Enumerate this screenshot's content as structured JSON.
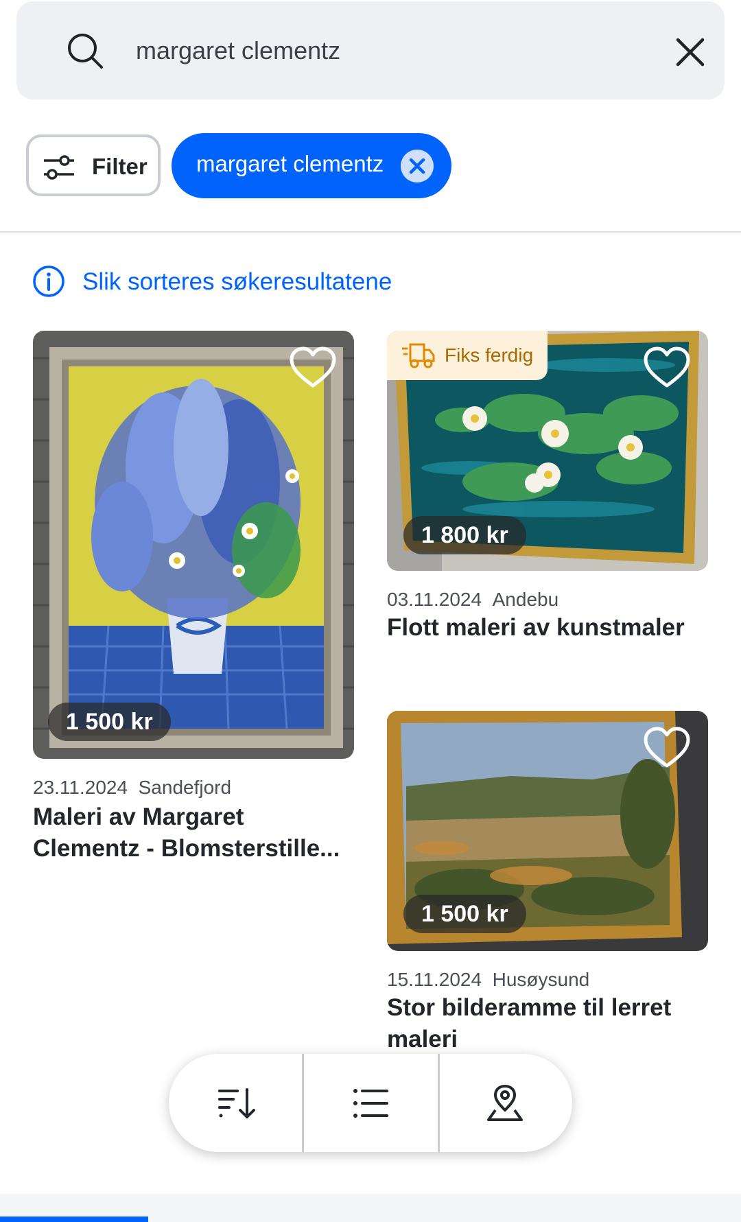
{
  "search": {
    "query": "margaret clementz"
  },
  "filters": {
    "filter_label": "Filter",
    "active_chip": "margaret clementz"
  },
  "info_link": "Slik sorteres søkeresultatene",
  "colors": {
    "accent": "#0063fb",
    "badge_bg": "#fdf1dc",
    "badge_text": "#a86a00"
  },
  "listings": [
    {
      "price": "1 500 kr",
      "date": "23.11.2024",
      "location": "Sandefjord",
      "title": "Maleri av Margaret Clementz - Blomsterstille...",
      "image": "painting-lupins-vase"
    },
    {
      "badge": "Fiks ferdig",
      "badge_icon": "delivery-truck-icon",
      "price": "1 800 kr",
      "date": "03.11.2024",
      "location": "Andebu",
      "title": "Flott maleri av kunstmaler",
      "image": "painting-water-lilies"
    },
    {
      "price": "1 500 kr",
      "date": "15.11.2024",
      "location": "Husøysund",
      "title": "Stor bilderamme til lerret maleri",
      "image": "painting-landscape"
    }
  ],
  "toolbar": {
    "items": [
      "sort-icon",
      "list-view-icon",
      "map-pin-icon"
    ]
  }
}
